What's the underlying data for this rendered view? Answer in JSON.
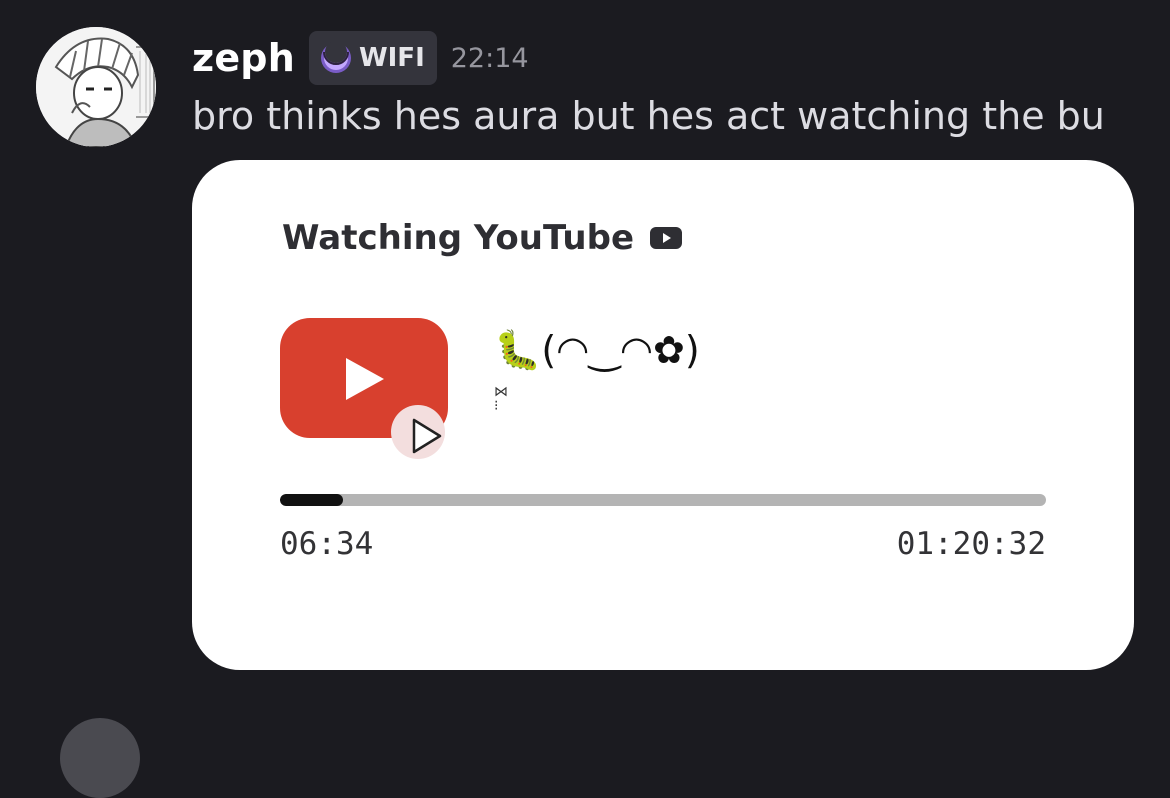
{
  "message": {
    "author": "zeph",
    "tag": {
      "label": "WIFI",
      "icon": "moon-badge-icon"
    },
    "timestamp": "22:14",
    "content": "bro thinks hes aura but hes act watching the bu"
  },
  "activity": {
    "title": "Watching YouTube",
    "title_icon": "youtube-icon",
    "app_icon": "youtube-logo-icon",
    "overlay_icon": "play-icon",
    "video_title": "🐛(◠‿◠✿)",
    "video_title_sub": "⋈\n⁝",
    "elapsed": "06:34",
    "total": "01:20:32",
    "progress_fraction": 0.0816
  },
  "colors": {
    "background": "#1b1b20",
    "youtube_red": "#d8402e",
    "card": "#ffffff",
    "progress_track": "#b4b4b4",
    "progress_fill": "#111111"
  }
}
